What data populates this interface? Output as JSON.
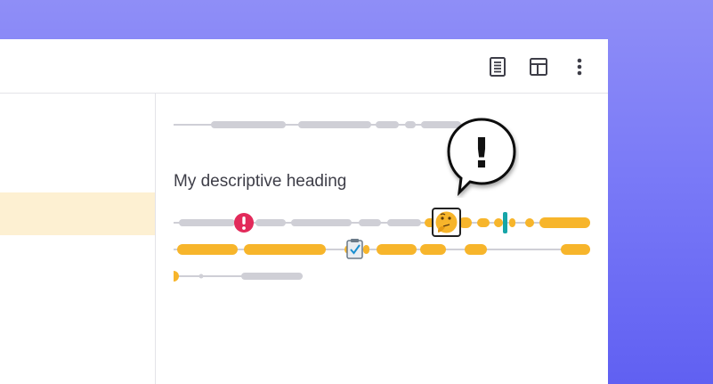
{
  "colors": {
    "accent_yellow": "#f7b52b",
    "skeleton_gray": "#cfcfd6",
    "alert_red": "#e22a5a",
    "marker_teal": "#17a5a8",
    "highlight_row": "#fdf0d2",
    "background_top": "#8f8ef7",
    "background_bottom": "#6060f2"
  },
  "toolbar": {
    "icons": [
      "document-icon",
      "layout-icon",
      "more-vertical-icon"
    ]
  },
  "content": {
    "heading": "My descriptive heading"
  },
  "timeline": {
    "markers": [
      "alert-icon",
      "thinking-face-icon",
      "clipboard-check-icon"
    ],
    "callout_symbol": "!"
  }
}
